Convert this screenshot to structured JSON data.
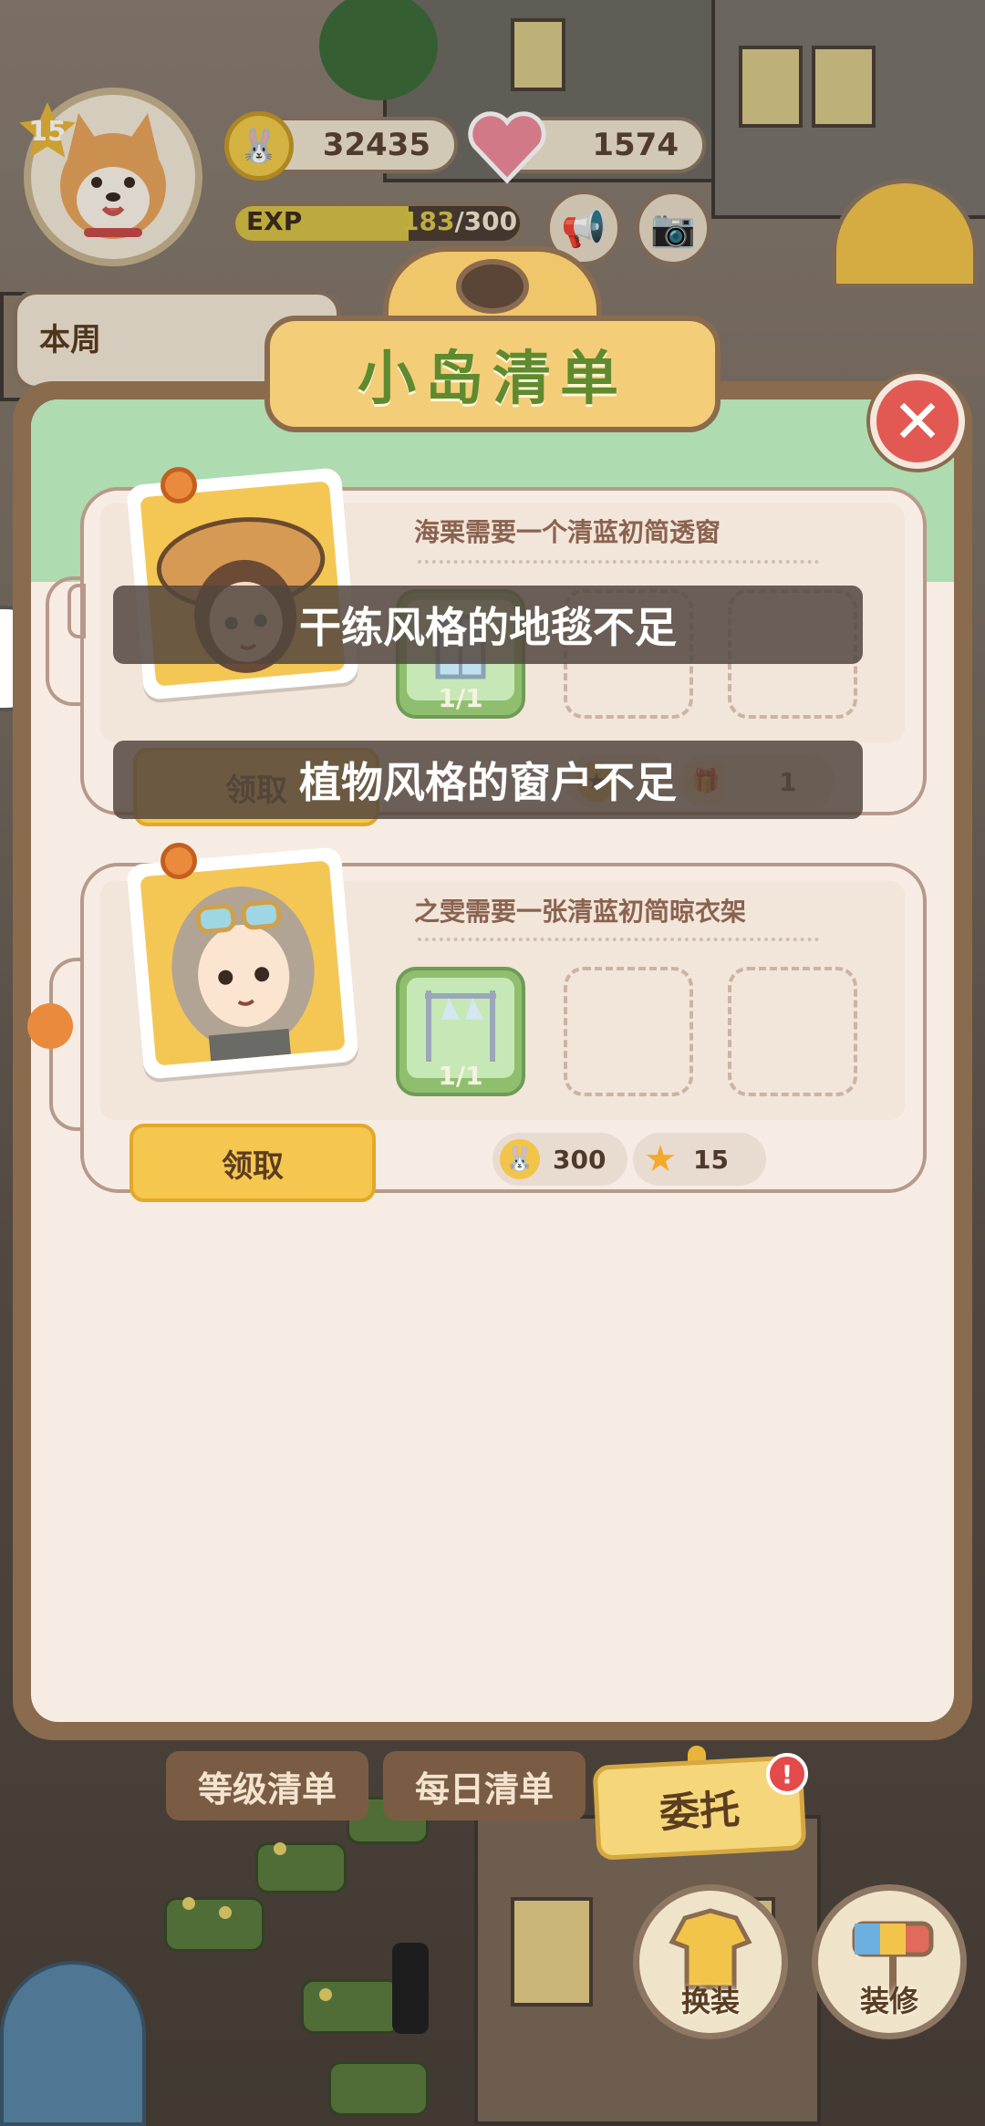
{
  "hud": {
    "level": "15",
    "coins": "32435",
    "hearts": "1574",
    "exp_label": "EXP",
    "exp_current": "183",
    "exp_max": "/300",
    "exp_progress": 0.61,
    "weekly_label": "本周"
  },
  "panel": {
    "title": "小岛清单",
    "close_label": "✕"
  },
  "cards": [
    {
      "request": "海栗需要一个清蓝初简透窗",
      "slot_count": "1/1",
      "claim_label": "领取",
      "reward_item_count": "1"
    },
    {
      "request": "之雯需要一张清蓝初简晾衣架",
      "slot_count": "1/1",
      "claim_label": "领取",
      "reward_coins": "300",
      "reward_stars": "15"
    }
  ],
  "toasts": [
    "干练风格的地毯不足",
    "植物风格的窗户不足"
  ],
  "tabs": {
    "level_list": "等级清单",
    "daily_list": "每日清单",
    "commission": "委托",
    "commission_badge": "!"
  },
  "buttons": {
    "outfit": "换装",
    "decorate": "装修"
  },
  "icons": {
    "coin": "coin-icon",
    "heart": "heart-icon",
    "star": "star-icon",
    "horn": "megaphone-icon",
    "camera": "camera-icon"
  },
  "colors": {
    "title_green": "#5f8a2f",
    "claim_yellow": "#f5c74f",
    "close_red": "#e25954"
  }
}
